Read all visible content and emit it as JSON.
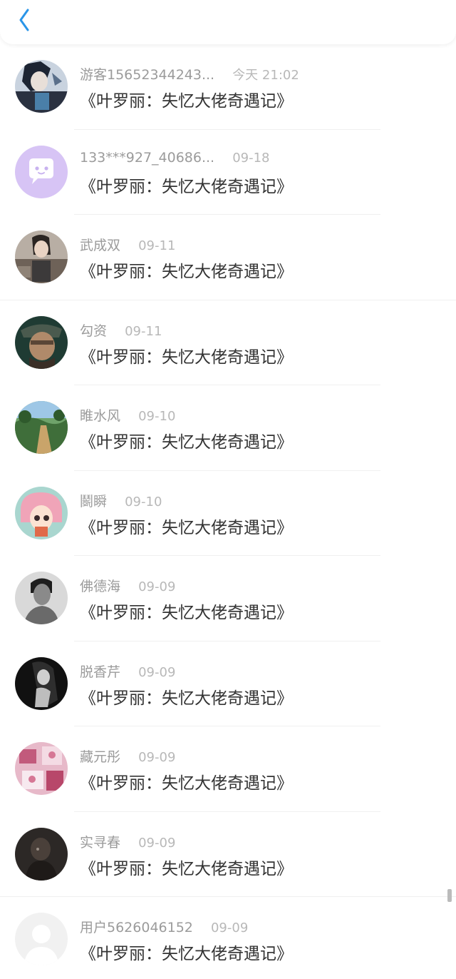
{
  "header": {
    "back_icon": "chevron-left-icon",
    "accent": "#2a95e8"
  },
  "items": [
    {
      "name": "游客15652344243...",
      "time": "今天 21:02",
      "title": "《叶罗丽：失忆大佬奇遇记》",
      "avatar": "anime-boy"
    },
    {
      "name": "133***927_40686...",
      "time": "09-18",
      "title": "《叶罗丽：失忆大佬奇遇记》",
      "avatar": "default-chat"
    },
    {
      "name": "武成双",
      "time": "09-11",
      "title": "《叶罗丽：失忆大佬奇遇记》",
      "avatar": "woman-photo"
    },
    {
      "name": "勾资",
      "time": "09-11",
      "title": "《叶罗丽：失忆大佬奇遇记》",
      "avatar": "man-cap"
    },
    {
      "name": "睢水风",
      "time": "09-10",
      "title": "《叶罗丽：失忆大佬奇遇记》",
      "avatar": "game-scene"
    },
    {
      "name": "鬬瞬",
      "time": "09-10",
      "title": "《叶罗丽：失忆大佬奇遇记》",
      "avatar": "anime-pink"
    },
    {
      "name": "佛德海",
      "time": "09-09",
      "title": "《叶罗丽：失忆大佬奇遇记》",
      "avatar": "man-bw"
    },
    {
      "name": "脱香芹",
      "time": "09-09",
      "title": "《叶罗丽：失忆大佬奇遇记》",
      "avatar": "woman-dark"
    },
    {
      "name": "藏元彤",
      "time": "09-09",
      "title": "《叶罗丽：失忆大佬奇遇记》",
      "avatar": "pink-pattern"
    },
    {
      "name": "实寻春",
      "time": "09-09",
      "title": "《叶罗丽：失忆大佬奇遇记》",
      "avatar": "dark-figure"
    },
    {
      "name": "用户5626046152",
      "time": "09-09",
      "title": "《叶罗丽：失忆大佬奇遇记》",
      "avatar": "default-user"
    }
  ]
}
